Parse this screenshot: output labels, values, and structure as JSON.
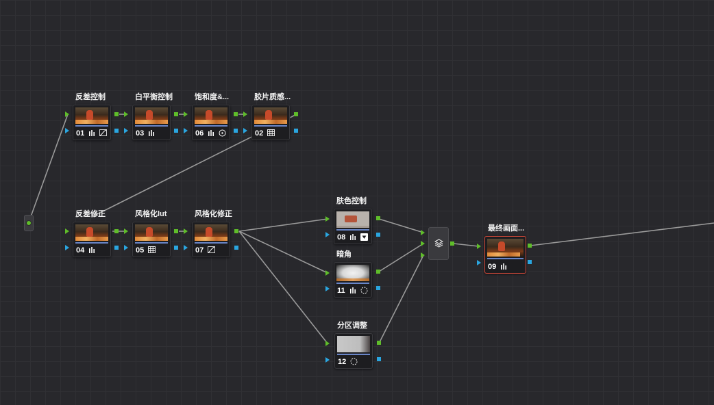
{
  "source": {
    "label": ""
  },
  "nodes": [
    {
      "id": "n01",
      "label": "反差控制",
      "number": "01",
      "icons": [
        "bars-icon",
        "curve-icon"
      ]
    },
    {
      "id": "n03",
      "label": "白平衡控制",
      "number": "03",
      "icons": [
        "bars-icon"
      ]
    },
    {
      "id": "n06",
      "label": "饱和度&...",
      "number": "06",
      "icons": [
        "bars-icon",
        "circle-icon"
      ]
    },
    {
      "id": "n02",
      "label": "胶片质感...",
      "number": "02",
      "icons": [
        "grid-icon"
      ]
    },
    {
      "id": "n04",
      "label": "反差修正",
      "number": "04",
      "icons": [
        "bars-icon"
      ]
    },
    {
      "id": "n05",
      "label": "风格化lut",
      "number": "05",
      "icons": [
        "grid-icon"
      ]
    },
    {
      "id": "n07",
      "label": "风格化修正",
      "number": "07",
      "icons": [
        "curve-icon"
      ]
    },
    {
      "id": "n08",
      "label": "肤色控制",
      "number": "08",
      "icons": [
        "bars-icon",
        "qualifier-icon"
      ]
    },
    {
      "id": "n11",
      "label": "暗角",
      "number": "11",
      "icons": [
        "bars-icon",
        "window-circle-icon"
      ]
    },
    {
      "id": "n12",
      "label": "分区调整",
      "number": "12",
      "icons": [
        "window-circle-icon"
      ]
    },
    {
      "id": "n09",
      "label": "最终画面...",
      "number": "09",
      "icons": [
        "bars-icon"
      ]
    }
  ],
  "mixer": {
    "icon": "layers-icon"
  },
  "colors": {
    "background": "#28282c",
    "rgb_port": "#5fbd2a",
    "alpha_port": "#2aa6e0",
    "selected_border": "#d34a3a",
    "wire": "#9a9a9a"
  }
}
